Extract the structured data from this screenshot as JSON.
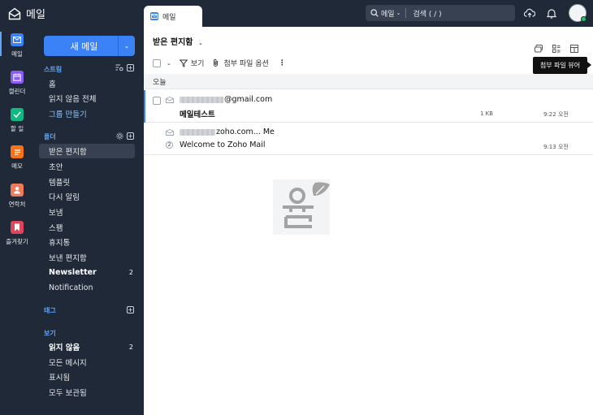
{
  "app": {
    "title": "메일"
  },
  "tabs": [
    {
      "label": "메일"
    }
  ],
  "search": {
    "scope": "메일",
    "placeholder": "검색 ( / )"
  },
  "rail": [
    {
      "label": "메일",
      "color": "#3b82f6",
      "active": true
    },
    {
      "label": "캘린더",
      "color": "#8b5cf6"
    },
    {
      "label": "할 일",
      "color": "#10b981"
    },
    {
      "label": "메모",
      "color": "#f97316"
    },
    {
      "label": "연락처",
      "color": "#ef7b5b"
    },
    {
      "label": "즐겨찾기",
      "color": "#ef4444"
    }
  ],
  "sidebar": {
    "new_mail": "새 메일",
    "streams": {
      "title": "스트림",
      "items": [
        "홈",
        "읽지 않음 전체",
        "그룹 만들기"
      ]
    },
    "folders": {
      "title": "폴더",
      "items": [
        {
          "label": "받은 편지함",
          "active": true
        },
        {
          "label": "초안"
        },
        {
          "label": "템플릿"
        },
        {
          "label": "다시 알림"
        },
        {
          "label": "보냄"
        },
        {
          "label": "스팸"
        },
        {
          "label": "휴지통"
        },
        {
          "label": "보낸 편지함"
        },
        {
          "label": "Newsletter",
          "count": "2",
          "bold": true
        },
        {
          "label": "Notification"
        }
      ]
    },
    "tags": {
      "title": "태그"
    },
    "views": {
      "title": "보기",
      "items": [
        {
          "label": "읽지 않음",
          "count": "2",
          "bold": true
        },
        {
          "label": "모든 메시지"
        },
        {
          "label": "표시됨"
        },
        {
          "label": "모두 보관됨"
        }
      ]
    }
  },
  "main": {
    "folder_title": "받은 편지함",
    "toolbar": {
      "view": "보기",
      "attach": "첨부 파일 옵션"
    },
    "tooltip": "첨부 파일 뷰어",
    "group": "오늘",
    "emails": [
      {
        "from_suffix": "@gmail.com",
        "subject": "메일테스트",
        "size": "1 KB",
        "time": "9:22 오전"
      },
      {
        "from_suffix": "zoho.com... Me",
        "subject": "Welcome to Zoho Mail",
        "thread_count": "2",
        "time": "9:13 오전"
      }
    ]
  }
}
